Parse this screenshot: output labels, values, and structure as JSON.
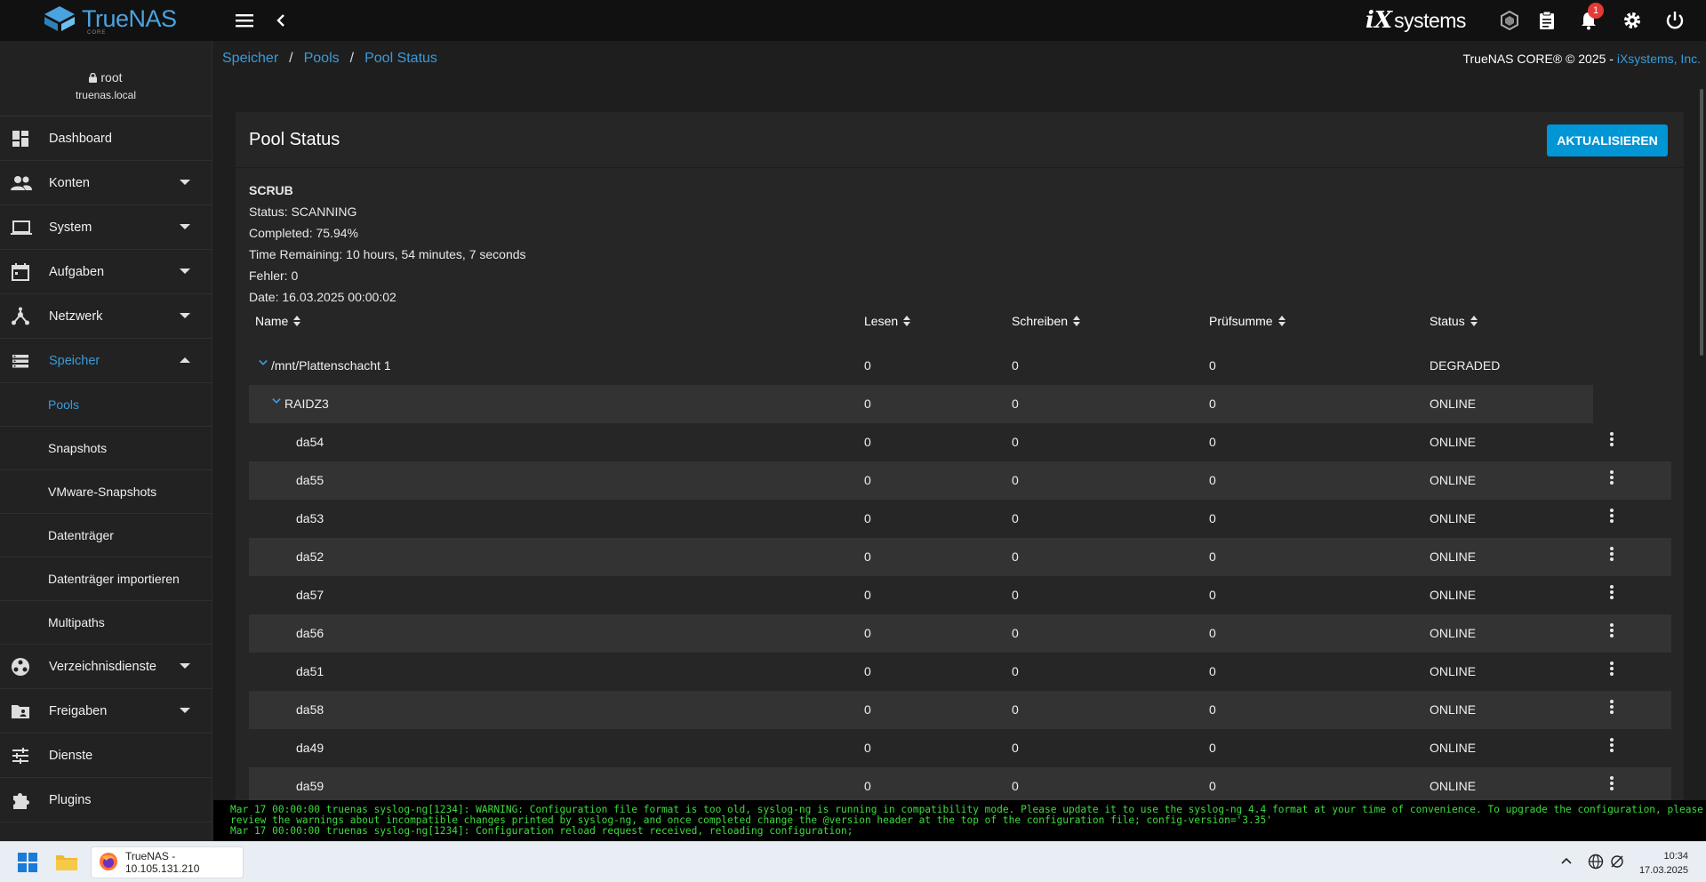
{
  "app": {
    "logo_text": "TrueNAS",
    "logo_sub": "CORE",
    "vendor_mark": "iX",
    "vendor_word": "systems",
    "notification_count": "1"
  },
  "breadcrumb": [
    "Speicher",
    "Pools",
    "Pool Status"
  ],
  "copyright": {
    "text": "TrueNAS CORE® © 2025 - ",
    "link": "iXsystems, Inc."
  },
  "user": {
    "name": "root",
    "host": "truenas.local"
  },
  "sidebar": {
    "items": [
      {
        "label": "Dashboard",
        "icon": "dashboard-icon"
      },
      {
        "label": "Konten",
        "icon": "people-icon"
      },
      {
        "label": "System",
        "icon": "laptop-icon"
      },
      {
        "label": "Aufgaben",
        "icon": "calendar-icon"
      },
      {
        "label": "Netzwerk",
        "icon": "network-icon"
      },
      {
        "label": "Speicher",
        "icon": "storage-icon"
      },
      {
        "label": "Verzeichnisdienste",
        "icon": "directory-icon"
      },
      {
        "label": "Freigaben",
        "icon": "folder-shared-icon"
      },
      {
        "label": "Dienste",
        "icon": "tune-icon"
      },
      {
        "label": "Plugins",
        "icon": "puzzle-icon"
      }
    ],
    "storage_sub": [
      "Pools",
      "Snapshots",
      "VMware-Snapshots",
      "Datenträger",
      "Datenträger importieren",
      "Multipaths"
    ]
  },
  "card": {
    "title": "Pool Status",
    "refresh_label": "AKTUALISIEREN"
  },
  "scrub": {
    "heading": "SCRUB",
    "status": "Status: SCANNING",
    "completed": "Completed: 75.94%",
    "remaining": "Time Remaining: 10 hours, 54 minutes, 7 seconds",
    "errors": "Fehler: 0",
    "date": "Date: 16.03.2025 00:00:02"
  },
  "table": {
    "columns": [
      "Name",
      "Lesen",
      "Schreiben",
      "Prüfsumme",
      "Status"
    ],
    "rows": [
      {
        "name": "/mnt/Plattenschacht 1",
        "read": "0",
        "write": "0",
        "checksum": "0",
        "status": "DEGRADED"
      },
      {
        "name": "RAIDZ3",
        "read": "0",
        "write": "0",
        "checksum": "0",
        "status": "ONLINE"
      },
      {
        "name": "da54",
        "read": "0",
        "write": "0",
        "checksum": "0",
        "status": "ONLINE"
      },
      {
        "name": "da55",
        "read": "0",
        "write": "0",
        "checksum": "0",
        "status": "ONLINE"
      },
      {
        "name": "da53",
        "read": "0",
        "write": "0",
        "checksum": "0",
        "status": "ONLINE"
      },
      {
        "name": "da52",
        "read": "0",
        "write": "0",
        "checksum": "0",
        "status": "ONLINE"
      },
      {
        "name": "da57",
        "read": "0",
        "write": "0",
        "checksum": "0",
        "status": "ONLINE"
      },
      {
        "name": "da56",
        "read": "0",
        "write": "0",
        "checksum": "0",
        "status": "ONLINE"
      },
      {
        "name": "da51",
        "read": "0",
        "write": "0",
        "checksum": "0",
        "status": "ONLINE"
      },
      {
        "name": "da58",
        "read": "0",
        "write": "0",
        "checksum": "0",
        "status": "ONLINE"
      },
      {
        "name": "da49",
        "read": "0",
        "write": "0",
        "checksum": "0",
        "status": "ONLINE"
      },
      {
        "name": "da59",
        "read": "0",
        "write": "0",
        "checksum": "0",
        "status": "ONLINE"
      }
    ]
  },
  "console": {
    "lines": [
      "Mar 17 00:00:00 truenas syslog-ng[1234]: WARNING: Configuration file format is too old, syslog-ng is running in compatibility mode. Please update it to use the syslog-ng 4.4 format at your time of convenience. To upgrade the configuration, please",
      "review the warnings about incompatible changes printed by syslog-ng, and once completed change the @version header at the top of the configuration file; config-version='3.35'",
      "Mar 17 00:00:00 truenas syslog-ng[1234]: Configuration reload request received, reloading configuration;"
    ]
  },
  "taskbar": {
    "app_label": "TrueNAS - 10.105.131.210",
    "time": "10:34",
    "date": "17.03.2025"
  },
  "colors": {
    "accent": "#3a9bd9",
    "button": "#0095d5",
    "console_text": "#3ddc3d"
  }
}
